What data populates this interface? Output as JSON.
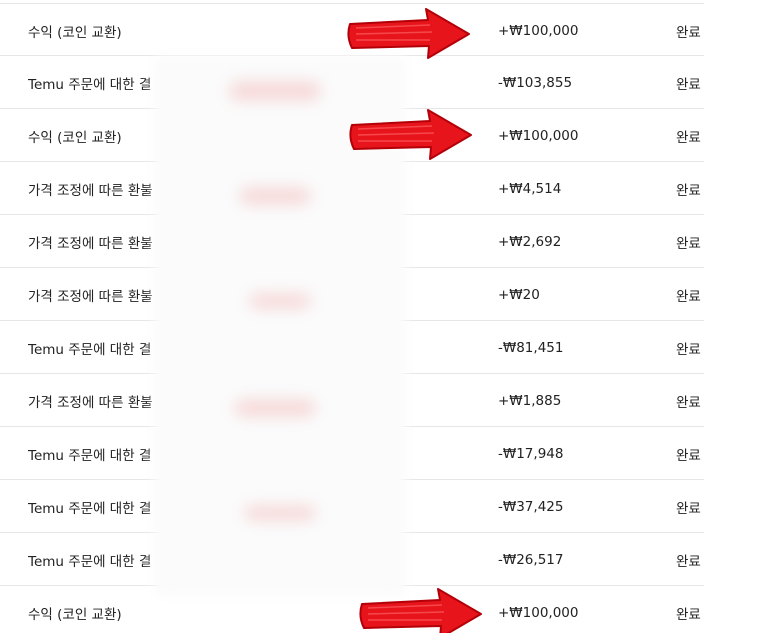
{
  "transactions": [
    {
      "description": "수익 (코인 교환)",
      "amount": "+₩100,000",
      "status": "완료"
    },
    {
      "description": "Temu 주문에 대한 결",
      "amount": "-₩103,855",
      "status": "완료"
    },
    {
      "description": "수익 (코인 교환)",
      "amount": "+₩100,000",
      "status": "완료"
    },
    {
      "description": "가격 조정에 따른 환불",
      "amount": "+₩4,514",
      "status": "완료"
    },
    {
      "description": "가격 조정에 따른 환불",
      "amount": "+₩2,692",
      "status": "완료"
    },
    {
      "description": "가격 조정에 따른 환불",
      "amount": "+₩20",
      "status": "완료"
    },
    {
      "description": "Temu 주문에 대한 결",
      "amount": "-₩81,451",
      "status": "완료"
    },
    {
      "description": "가격 조정에 따른 환불",
      "amount": "+₩1,885",
      "status": "완료"
    },
    {
      "description": "Temu 주문에 대한 결",
      "amount": "-₩17,948",
      "status": "완료"
    },
    {
      "description": "Temu 주문에 대한 결",
      "amount": "-₩37,425",
      "status": "완료"
    },
    {
      "description": "Temu 주문에 대한 결",
      "amount": "-₩26,517",
      "status": "완료"
    },
    {
      "description": "수익 (코인 교환)",
      "amount": "+₩100,000",
      "status": "완료"
    }
  ],
  "annotations": {
    "arrow_color": "#e8141c",
    "arrow_icon": "red-arrow-right-icon",
    "highlighted_rows": [
      0,
      2,
      11
    ]
  },
  "colors": {
    "text": "#222222",
    "divider": "#e6e6e6",
    "background": "#ffffff"
  }
}
